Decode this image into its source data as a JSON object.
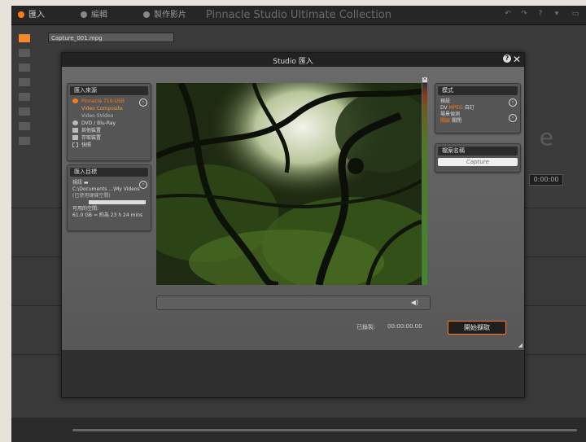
{
  "app": {
    "title": "Pinnacle Studio Ultimate Collection",
    "tabs": [
      {
        "label": "匯入",
        "active": true
      },
      {
        "label": "編輯",
        "active": false
      },
      {
        "label": "製作影片",
        "active": false
      }
    ],
    "window_controls": [
      "undo",
      "redo",
      "help",
      "settings",
      "window"
    ],
    "library_dropdown": "Capture_001.mpg",
    "right_partial_text": "e",
    "timecode": "0:00:00",
    "accent": "#ff7a16"
  },
  "dialog": {
    "title": "Studio 匯入",
    "help": "?",
    "close": "✕",
    "source": {
      "header": "匯入來源",
      "items": [
        {
          "label": "Pinnacle 710-USB",
          "selected": true,
          "icon": "capture-device-icon"
        },
        {
          "label": "DVD / Blu-Ray",
          "icon": "disc-icon"
        },
        {
          "label": "其他裝置",
          "icon": "folder-icon"
        },
        {
          "label": "存取裝置",
          "icon": "storage-icon"
        },
        {
          "label": "快照",
          "icon": "snapshot-icon"
        }
      ],
      "sub_selected": "Video Composite",
      "sub_other": "Video SVideo"
    },
    "target": {
      "header": "匯入目標",
      "video_label": "視訊 ",
      "path": "C:\\Documents ...\\My Videos",
      "disk_label": "(已使用硬碟空間)",
      "free_label": "可用的空間:",
      "free_value": "61.0 GB = 約為 23 h 24 mins"
    },
    "mode": {
      "header": "模式",
      "preset_label": "預設",
      "formats": [
        "DV",
        "MPEG",
        "自訂"
      ],
      "active_format": "MPEG",
      "scene_label": "場景偵測",
      "scene_options": [
        "開啟",
        "關閉"
      ],
      "scene_active": "開啟"
    },
    "filename": {
      "header": "檔案名稱",
      "value": "Capture"
    },
    "duration_label": "已錄製:",
    "duration_value": "00:00:00.00",
    "capture_button": "開始擷取",
    "volume_icon": "◀)"
  }
}
